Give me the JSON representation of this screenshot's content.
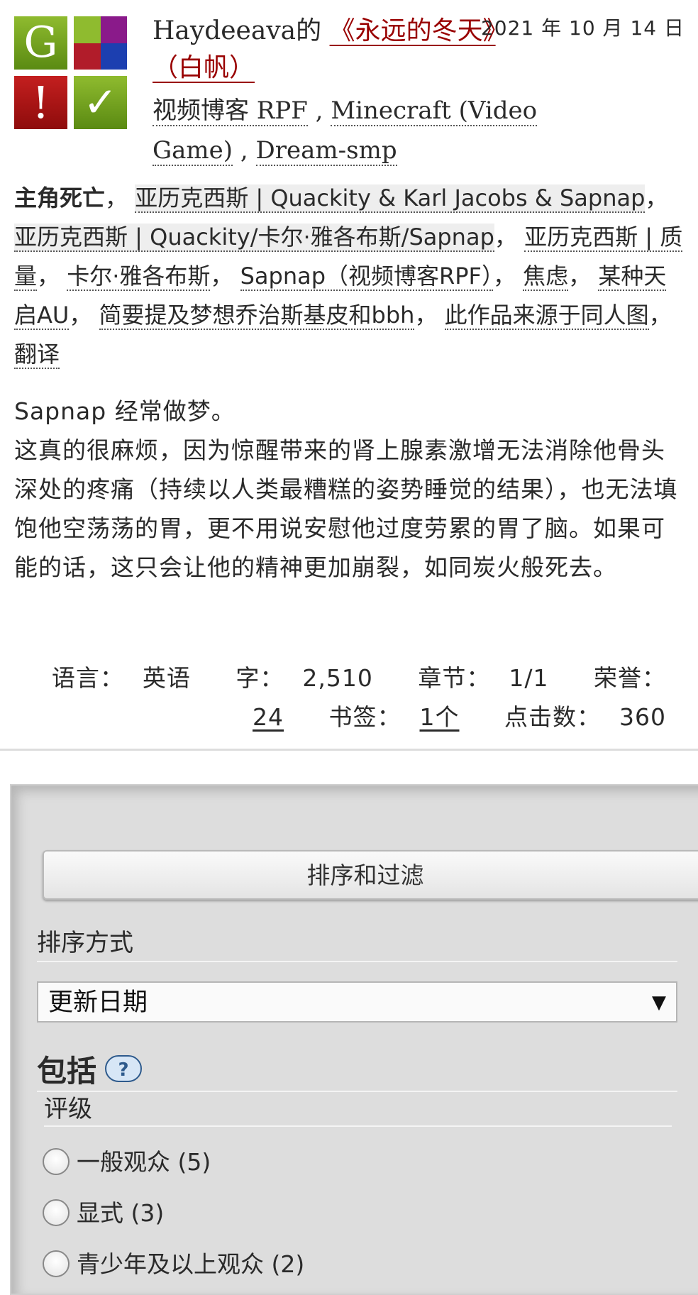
{
  "work": {
    "author": "Haydeeava的",
    "title": "《永远的冬天》（白帆）",
    "date": "2021 年 10 月 14 日",
    "rating_icons": {
      "rating": "G",
      "warning": "!",
      "complete": "✓"
    },
    "fandoms": [
      "视频博客 RPF",
      "Minecraft (Video Game)",
      "Dream-smp"
    ],
    "fandom_separator": " , ",
    "warning_tag": "主角死亡",
    "relationship_tags": [
      "亚历克西斯 | Quackity & Karl Jacobs & Sapnap",
      "亚历克西斯 | Quackity/卡尔·雅各布斯/Sapnap"
    ],
    "tags": [
      "亚历克西斯 | 质量",
      "卡尔·雅各布斯",
      "Sapnap（视频博客RPF）",
      "焦虑",
      "某种天启AU",
      "简要提及梦想乔治斯基皮和bbh",
      "此作品来源于同人图",
      "翻译"
    ],
    "summary": [
      "Sapnap 经常做梦。",
      "这真的很麻烦，因为惊醒带来的肾上腺素激增无法消除他骨头深处的疼痛（持续以人类最糟糕的姿势睡觉的结果），也无法填饱他空荡荡的胃，更不用说安慰他过度劳累的胃了脑。如果可能的话，这只会让他的精神更加崩裂，如同炭火般死去。"
    ],
    "stats": {
      "language_label": "语言：",
      "language": "英语",
      "words_label": "字：",
      "words": "2,510",
      "chapters_label": "章节：",
      "chapters": "1/1",
      "kudos_label": "荣誉：",
      "kudos": "24",
      "bookmarks_label": "书签：",
      "bookmarks": "1个",
      "hits_label": "点击数：",
      "hits": "360"
    }
  },
  "filters": {
    "sort_filter_button": "排序和过滤",
    "sort_label": "排序方式",
    "sort_selected": "更新日期",
    "include_heading": "包括",
    "help_icon": "?",
    "rating_legend": "评级",
    "rating_options": [
      {
        "label": "一般观众 (5)"
      },
      {
        "label": "显式 (3)"
      },
      {
        "label": "青少年及以上观众 (2)"
      }
    ]
  },
  "colors": {
    "title_link": "#990000",
    "panel_bg": "#dddddd",
    "rating_green": "#5a8a12",
    "warning_red": "#8e0c0c"
  }
}
